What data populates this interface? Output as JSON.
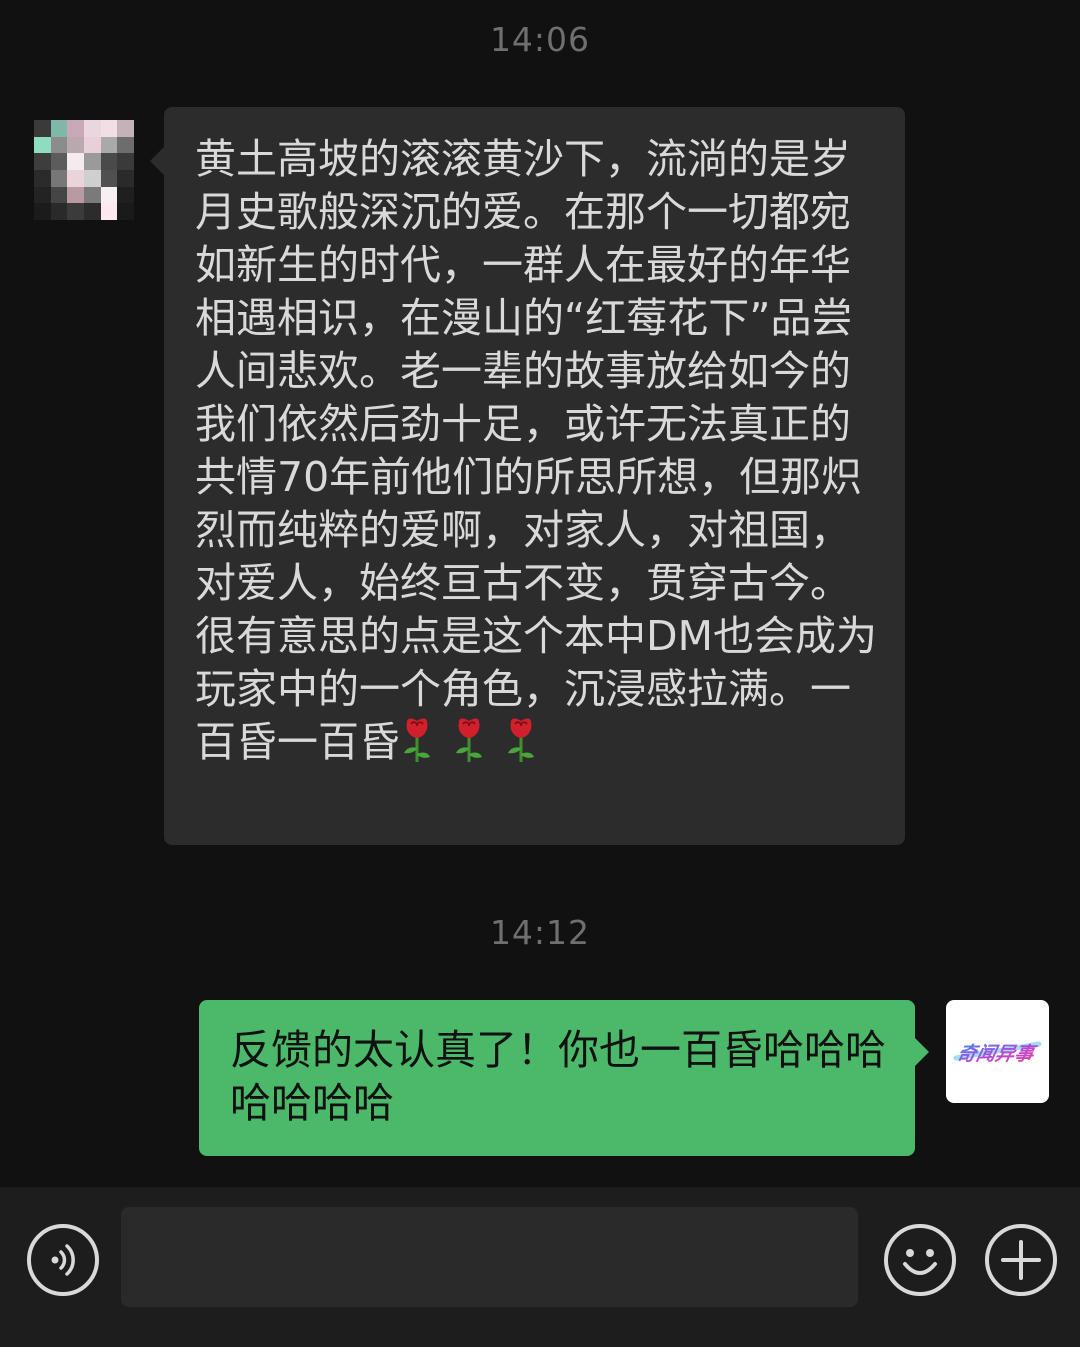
{
  "chat": {
    "timestamps": [
      "14:06",
      "14:12"
    ],
    "messages": [
      {
        "direction": "incoming",
        "text": "黄土高坡的滚滚黄沙下，流淌的是岁月史歌般深沉的爱。在那个一切都宛如新生的时代，一群人在最好的年华相遇相识，在漫山的“红莓花下”品尝人间悲欢。老一辈的故事放给如今的我们依然后劲十足，或许无法真正的共情70年前他们的所思所想，但那炽烈而纯粹的爱啊，对家人，对祖国，对爱人，始终亘古不变，贯穿古今。很有意思的点是这个本中DM也会成为玩家中的一个角色，沉浸感拉满。一百昏一百昏",
        "emoji_icon": "rose-icon",
        "emoji_count": 3
      },
      {
        "direction": "outgoing",
        "text": "反馈的太认真了！你也一百昏哈哈哈哈哈哈哈",
        "avatar_logo_text": "奇闻异事"
      }
    ]
  },
  "input_bar": {
    "voice_icon": "voice-icon",
    "text_value": "",
    "emoji_icon": "smiley-icon",
    "more_icon": "plus-icon"
  },
  "colors": {
    "background": "#111111",
    "incoming_bubble": "#2c2c2c",
    "outgoing_bubble": "#4cb96a",
    "input_bar": "#1d1d1d",
    "text_light": "#d9d9d9",
    "timestamp": "#6f6f6f"
  }
}
